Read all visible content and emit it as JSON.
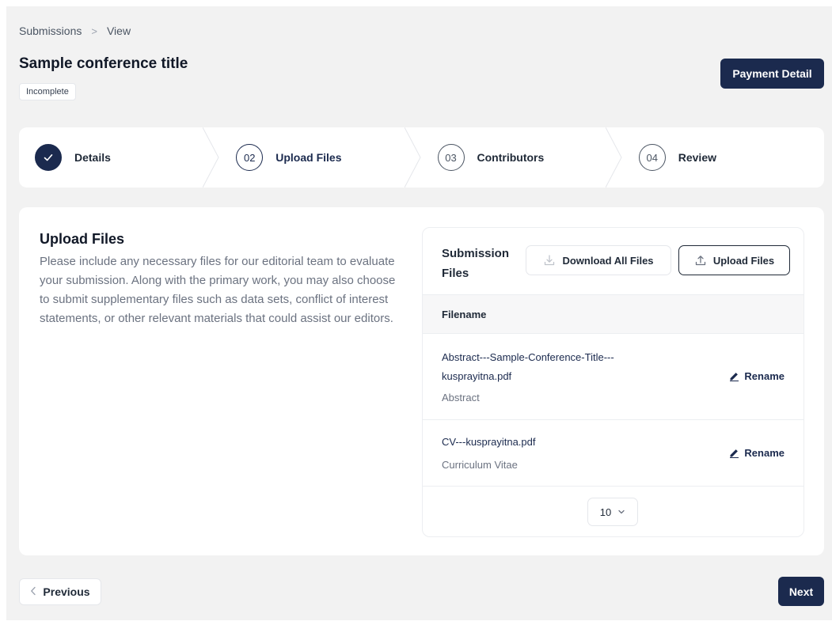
{
  "breadcrumb": {
    "items": [
      "Submissions",
      "View"
    ],
    "separator": ">"
  },
  "header": {
    "title": "Sample conference title",
    "status": "Incomplete",
    "payment_label": "Payment Detail"
  },
  "stepper": {
    "steps": [
      {
        "number": "",
        "label": "Details",
        "state": "done",
        "icon": "check-icon"
      },
      {
        "number": "02",
        "label": "Upload Files",
        "state": "active"
      },
      {
        "number": "03",
        "label": "Contributors",
        "state": "upcoming"
      },
      {
        "number": "04",
        "label": "Review",
        "state": "upcoming"
      }
    ]
  },
  "section": {
    "title": "Upload Files",
    "description": "Please include any necessary files for our editorial team to evaluate your submission. Along with the primary work, you may also choose to submit supplementary files such as data sets, conflict of interest statements, or other relevant materials that could assist our editors."
  },
  "files": {
    "title": "Submission Files",
    "download_all_label": "Download All Files",
    "upload_label": "Upload Files",
    "column_header": "Filename",
    "rows": [
      {
        "filename": "Abstract---Sample-Conference-Title---kusprayitna.pdf",
        "type": "Abstract",
        "action": "Rename"
      },
      {
        "filename": "CV---kusprayitna.pdf",
        "type": "Curriculum Vitae",
        "action": "Rename"
      }
    ],
    "page_size": "10"
  },
  "footer": {
    "previous_label": "Previous",
    "next_label": "Next"
  },
  "colors": {
    "primary": "#1b2a4e",
    "background": "#f2f2f2",
    "muted_text": "#6b7280"
  }
}
